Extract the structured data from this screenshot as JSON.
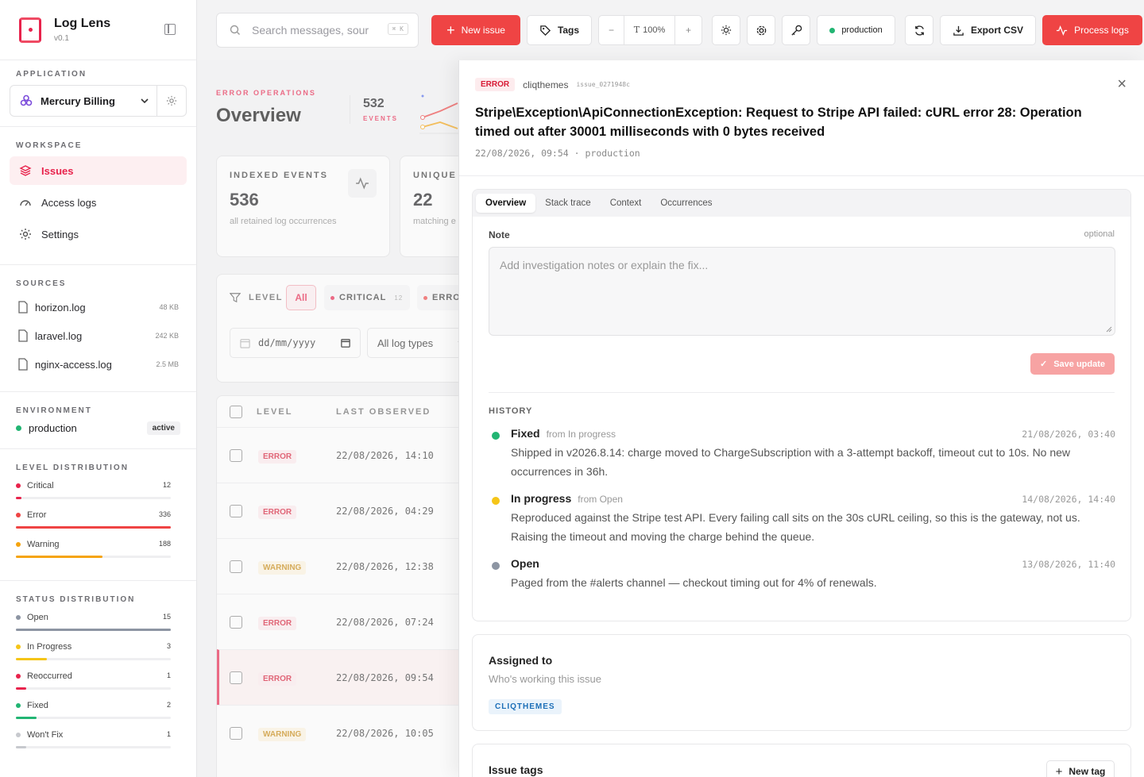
{
  "brand": {
    "name": "Log Lens",
    "version": "v0.1"
  },
  "search": {
    "placeholder": "Search messages, sour",
    "kbd": "⌘ K"
  },
  "toolbar": {
    "new_issue": "New issue",
    "tags": "Tags",
    "zoom": "100%",
    "env": "production",
    "export": "Export CSV",
    "process": "Process logs"
  },
  "sidebar": {
    "application_title": "APPLICATION",
    "application": "Mercury Billing",
    "workspace_title": "WORKSPACE",
    "nav": [
      {
        "label": "Issues"
      },
      {
        "label": "Access logs"
      },
      {
        "label": "Settings"
      }
    ],
    "sources_title": "SOURCES",
    "sources": [
      {
        "name": "horizon.log",
        "size": "48 KB"
      },
      {
        "name": "laravel.log",
        "size": "242 KB"
      },
      {
        "name": "nginx-access.log",
        "size": "2.5 MB"
      }
    ],
    "environment_title": "ENVIRONMENT",
    "environment": "production",
    "environment_badge": "active",
    "level_title": "LEVEL DISTRIBUTION",
    "levels": [
      {
        "label": "Critical",
        "count": "12",
        "fraction": 0.035,
        "color": "#e8234c"
      },
      {
        "label": "Error",
        "count": "336",
        "fraction": 1.0,
        "color": "#ef4444"
      },
      {
        "label": "Warning",
        "count": "188",
        "fraction": 0.56,
        "color": "#f5a40f"
      }
    ],
    "status_title": "STATUS DISTRIBUTION",
    "statuses": [
      {
        "label": "Open",
        "count": "15",
        "fraction": 1.0,
        "color": "#8d95a3"
      },
      {
        "label": "In Progress",
        "count": "3",
        "fraction": 0.2,
        "color": "#f5c518"
      },
      {
        "label": "Reoccurred",
        "count": "1",
        "fraction": 0.067,
        "color": "#e8234c"
      },
      {
        "label": "Fixed",
        "count": "2",
        "fraction": 0.133,
        "color": "#22b573"
      },
      {
        "label": "Won't Fix",
        "count": "1",
        "fraction": 0.067,
        "color": "#c7c9ce"
      }
    ]
  },
  "main": {
    "label": "ERROR OPERATIONS",
    "title": "Overview",
    "events_count": "532",
    "events_label": "EVENTS",
    "cards": [
      {
        "title": "INDEXED EVENTS",
        "value": "536",
        "sub": "all retained log occurrences"
      },
      {
        "title": "UNIQUE",
        "value": "22",
        "sub": "matching e"
      }
    ],
    "filter": {
      "level_label": "LEVEL",
      "all": "All",
      "critical": "CRITICAL",
      "critical_count": "12",
      "error": "ERRO",
      "date_placeholder": "dd/mm/yyyy",
      "log_types": "All log types"
    },
    "table": {
      "col_level": "LEVEL",
      "col_last": "LAST OBSERVED",
      "rows": [
        {
          "level": "ERROR",
          "date": "22/08/2026, 14:10"
        },
        {
          "level": "ERROR",
          "date": "22/08/2026, 04:29"
        },
        {
          "level": "WARNING",
          "date": "22/08/2026, 12:38"
        },
        {
          "level": "ERROR",
          "date": "22/08/2026, 07:24"
        },
        {
          "level": "ERROR",
          "date": "22/08/2026, 09:54"
        },
        {
          "level": "WARNING",
          "date": "22/08/2026, 10:05"
        }
      ]
    }
  },
  "panel": {
    "level": "ERROR",
    "source": "cliqthemes",
    "issue_id": "issue_0271948c",
    "title": "Stripe\\Exception\\ApiConnectionException: Request to Stripe API failed: cURL error 28: Operation timed out after 30001 milliseconds with 0 bytes received",
    "meta": "22/08/2026, 09:54 · production",
    "tabs": [
      "Overview",
      "Stack trace",
      "Context",
      "Occurrences"
    ],
    "note_label": "Note",
    "note_optional": "optional",
    "note_placeholder": "Add investigation notes or explain the fix...",
    "save": "Save update",
    "history_title": "HISTORY",
    "history": [
      {
        "status": "Fixed",
        "from": "from In progress",
        "time": "21/08/2026, 03:40",
        "text": "Shipped in v2026.8.14: charge moved to ChargeSubscription with a 3-attempt backoff, timeout cut to 10s. No new occurrences in 36h.",
        "color": "#22b573"
      },
      {
        "status": "In progress",
        "from": "from Open",
        "time": "14/08/2026, 14:40",
        "text": "Reproduced against the Stripe test API. Every failing call sits on the 30s cURL ceiling, so this is the gateway, not us. Raising the timeout and moving the charge behind the queue.",
        "color": "#f5c518"
      },
      {
        "status": "Open",
        "from": "",
        "time": "13/08/2026, 11:40",
        "text": "Paged from the #alerts channel — checkout timing out for 4% of renewals.",
        "color": "#8d95a3"
      }
    ],
    "assigned_title": "Assigned to",
    "assigned_sub": "Who's working this issue",
    "assignee": "CLIQTHEMES",
    "tags_title": "Issue tags",
    "new_tag": "New tag"
  }
}
